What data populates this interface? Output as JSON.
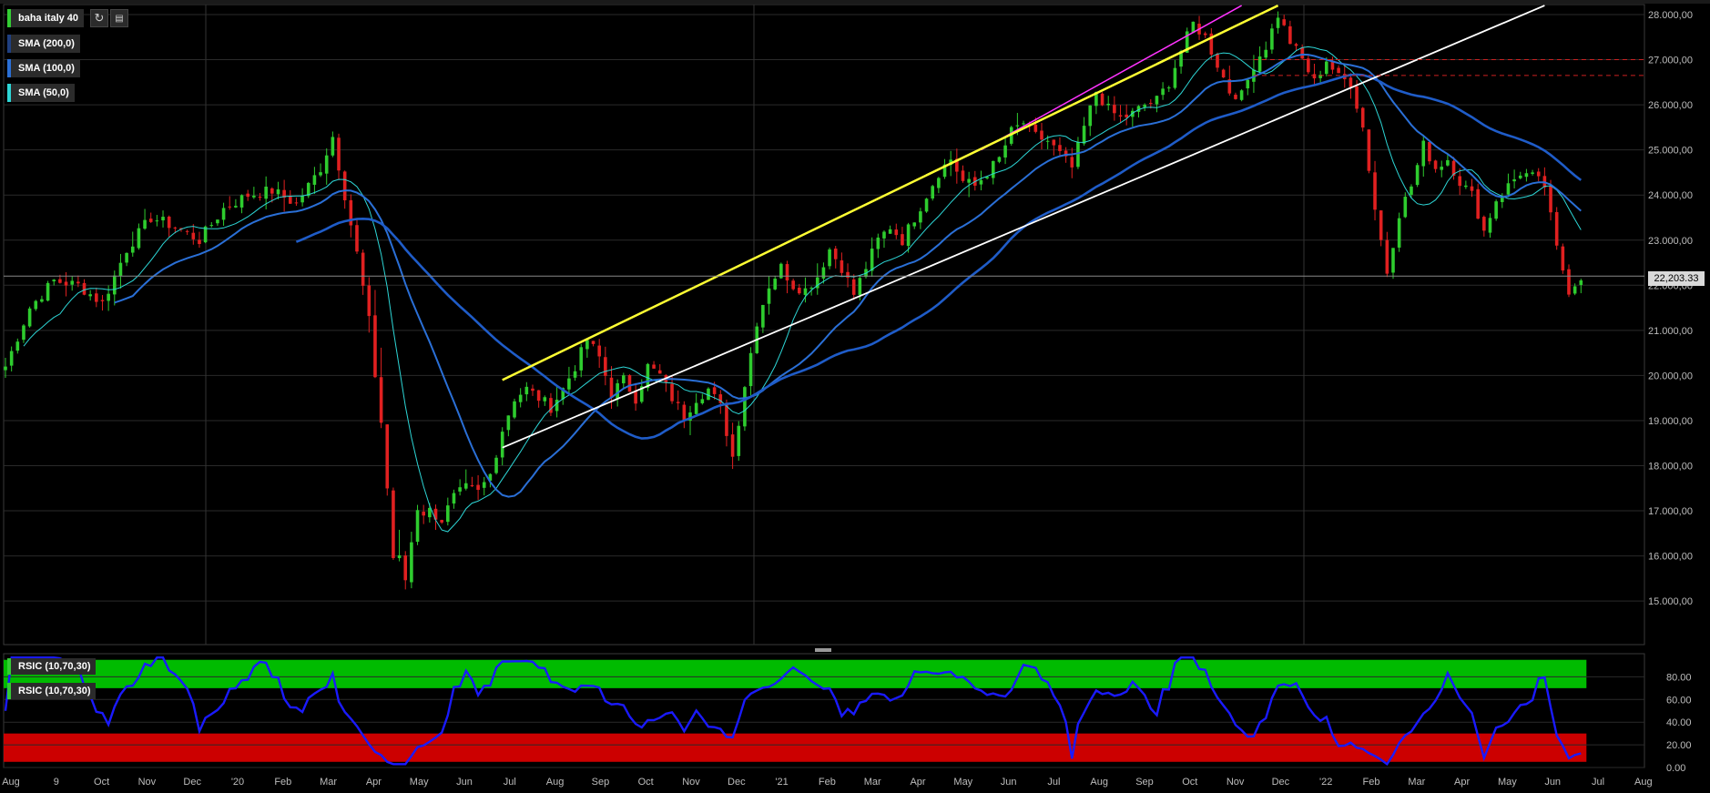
{
  "main_legend": {
    "instrument": "baha italy 40",
    "sma200": "SMA (200,0)",
    "sma100": "SMA (100,0)",
    "sma50": "SMA (50,0)"
  },
  "toolbar": {
    "refresh_icon": "refresh-icon",
    "bars_icon": "bar-chart-icon"
  },
  "rsi_legend": {
    "label1": "RSIC (10,70,30)",
    "label2": "RSIC (10,70,30)"
  },
  "last_price": "22,203.33",
  "colors": {
    "up_candle": "#2ecc2e",
    "down_candle": "#e02020",
    "sma50": "#2dd6d6",
    "sma100": "#2a6fd6",
    "sma200": "#1f5cc8",
    "channel_yellow": "#ffff33",
    "channel_magenta": "#ff33ff",
    "channel_white": "#ffffff",
    "rsi_line": "#1a1aff",
    "rsi_overbought": "#00bb00",
    "rsi_oversold": "#cc0000"
  },
  "price_axis": {
    "labels": [
      "28.000,00",
      "27.000,00",
      "26.000,00",
      "25.000,00",
      "24.000,00",
      "23.000,00",
      "22.000,00",
      "21.000,00",
      "20.000,00",
      "19.000,00",
      "18.000,00",
      "17.000,00",
      "16.000,00",
      "15.000,00"
    ]
  },
  "rsi_axis": {
    "labels": [
      "80.00",
      "60.00",
      "40.00",
      "20.00",
      "0.00"
    ]
  },
  "time_axis": {
    "labels": [
      "Aug",
      "9",
      "Oct",
      "Nov",
      "Dec",
      "'20",
      "Feb",
      "Mar",
      "Apr",
      "May",
      "Jun",
      "Jul",
      "Aug",
      "Sep",
      "Oct",
      "Nov",
      "Dec",
      "'21",
      "Feb",
      "Mar",
      "Apr",
      "May",
      "Jun",
      "Jul",
      "Aug",
      "Sep",
      "Oct",
      "Nov",
      "Dec",
      "'22",
      "Feb",
      "Mar",
      "Apr",
      "May",
      "Jun",
      "Jul",
      "Aug"
    ]
  },
  "chart_data": {
    "type": "candlestick",
    "title": "baha italy 40",
    "ylim": [
      14000,
      28200
    ],
    "rsi_ylim": [
      0,
      100
    ],
    "rsi_overbought": 70,
    "rsi_oversold": 30,
    "close_anchors": [
      [
        0,
        20200
      ],
      [
        4,
        21500
      ],
      [
        8,
        22100
      ],
      [
        12,
        22000
      ],
      [
        16,
        21600
      ],
      [
        20,
        22800
      ],
      [
        24,
        23500
      ],
      [
        28,
        23300
      ],
      [
        32,
        23000
      ],
      [
        36,
        23700
      ],
      [
        40,
        24000
      ],
      [
        44,
        24100
      ],
      [
        48,
        23800
      ],
      [
        52,
        24600
      ],
      [
        54,
        25300
      ],
      [
        56,
        24000
      ],
      [
        58,
        22700
      ],
      [
        60,
        21200
      ],
      [
        62,
        19000
      ],
      [
        64,
        16000
      ],
      [
        66,
        15500
      ],
      [
        68,
        17200
      ],
      [
        70,
        17000
      ],
      [
        72,
        16800
      ],
      [
        74,
        17300
      ],
      [
        76,
        17500
      ],
      [
        78,
        17400
      ],
      [
        80,
        17800
      ],
      [
        82,
        18800
      ],
      [
        84,
        19500
      ],
      [
        86,
        19700
      ],
      [
        88,
        19500
      ],
      [
        90,
        19300
      ],
      [
        92,
        19700
      ],
      [
        94,
        20200
      ],
      [
        96,
        20800
      ],
      [
        98,
        20400
      ],
      [
        100,
        19600
      ],
      [
        102,
        19900
      ],
      [
        104,
        19500
      ],
      [
        106,
        20200
      ],
      [
        108,
        20000
      ],
      [
        110,
        19500
      ],
      [
        112,
        19100
      ],
      [
        114,
        19500
      ],
      [
        116,
        19700
      ],
      [
        118,
        19300
      ],
      [
        120,
        18200
      ],
      [
        122,
        19800
      ],
      [
        124,
        21200
      ],
      [
        126,
        22000
      ],
      [
        128,
        22400
      ],
      [
        130,
        22000
      ],
      [
        132,
        21900
      ],
      [
        134,
        22200
      ],
      [
        136,
        22800
      ],
      [
        138,
        22400
      ],
      [
        140,
        21800
      ],
      [
        142,
        22400
      ],
      [
        144,
        23000
      ],
      [
        146,
        23300
      ],
      [
        148,
        23000
      ],
      [
        150,
        23500
      ],
      [
        152,
        24000
      ],
      [
        154,
        24500
      ],
      [
        156,
        24800
      ],
      [
        158,
        24300
      ],
      [
        160,
        24200
      ],
      [
        162,
        24500
      ],
      [
        164,
        24800
      ],
      [
        166,
        25400
      ],
      [
        168,
        25600
      ],
      [
        170,
        25300
      ],
      [
        172,
        25200
      ],
      [
        174,
        24900
      ],
      [
        176,
        24600
      ],
      [
        178,
        25500
      ],
      [
        180,
        26300
      ],
      [
        182,
        25900
      ],
      [
        184,
        25700
      ],
      [
        186,
        25800
      ],
      [
        188,
        26000
      ],
      [
        190,
        26100
      ],
      [
        192,
        26500
      ],
      [
        194,
        27200
      ],
      [
        196,
        27800
      ],
      [
        198,
        27500
      ],
      [
        200,
        26900
      ],
      [
        202,
        26300
      ],
      [
        204,
        26200
      ],
      [
        206,
        26900
      ],
      [
        208,
        27300
      ],
      [
        210,
        28000
      ],
      [
        212,
        27400
      ],
      [
        214,
        27000
      ],
      [
        216,
        26500
      ],
      [
        218,
        27000
      ],
      [
        220,
        26600
      ],
      [
        222,
        26500
      ],
      [
        224,
        25500
      ],
      [
        226,
        23700
      ],
      [
        228,
        22300
      ],
      [
        230,
        23600
      ],
      [
        232,
        24200
      ],
      [
        234,
        25100
      ],
      [
        236,
        24600
      ],
      [
        238,
        24800
      ],
      [
        240,
        24300
      ],
      [
        242,
        24000
      ],
      [
        244,
        23200
      ],
      [
        246,
        23900
      ],
      [
        248,
        24200
      ],
      [
        250,
        24500
      ],
      [
        252,
        24400
      ],
      [
        254,
        24200
      ],
      [
        256,
        22800
      ],
      [
        258,
        21900
      ],
      [
        260,
        22203
      ]
    ],
    "channels": [
      {
        "name": "magenta",
        "from": [
          161,
          25000
        ],
        "to": [
          204,
          28200
        ]
      },
      {
        "name": "yellow",
        "from": [
          82,
          19900
        ],
        "to": [
          210,
          28200
        ]
      },
      {
        "name": "white",
        "from": [
          82,
          18400
        ],
        "to": [
          254,
          28200
        ]
      }
    ],
    "resistance_levels": [
      27000,
      26650
    ],
    "last_price": 22203.33
  }
}
